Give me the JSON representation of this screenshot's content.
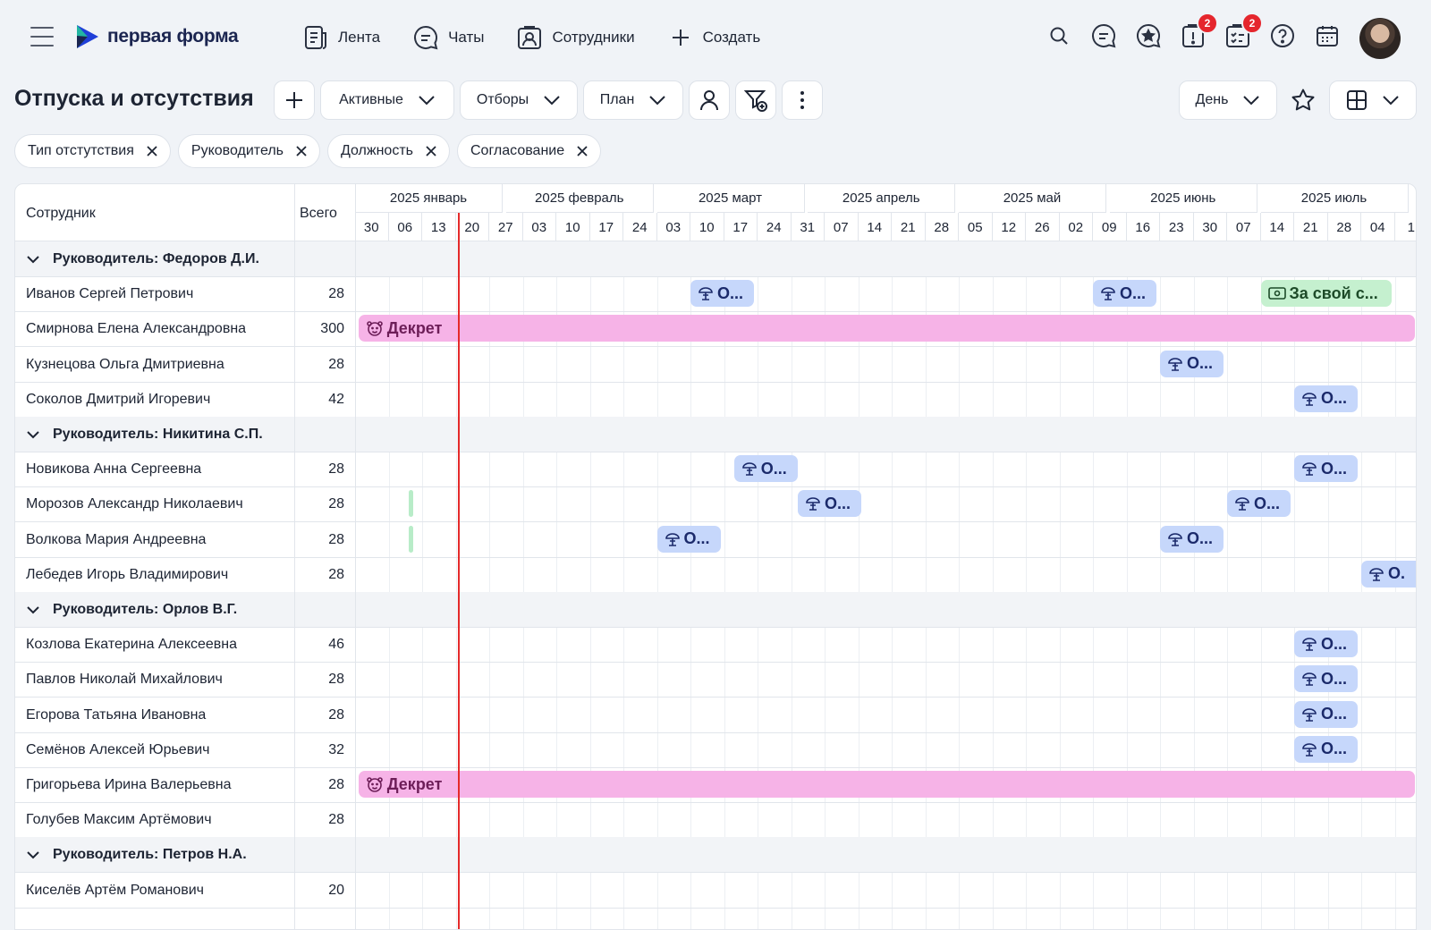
{
  "brand": {
    "name": "первая форма"
  },
  "nav": [
    {
      "label": "Лента",
      "icon": "feed-icon"
    },
    {
      "label": "Чаты",
      "icon": "chat-icon"
    },
    {
      "label": "Сотрудники",
      "icon": "employees-icon"
    },
    {
      "label": "Создать",
      "icon": "plus-icon"
    }
  ],
  "badges": {
    "alerts": "2",
    "tasks": "2"
  },
  "page": {
    "title": "Отпуска и отсутствия"
  },
  "toolbar": {
    "status": "Активные",
    "filters": "Отборы",
    "plan": "План",
    "scale": "День"
  },
  "chips": [
    "Тип отстутствия",
    "Руководитель",
    "Должность",
    "Согласование"
  ],
  "table": {
    "col_employee": "Сотрудник",
    "col_total": "Всего",
    "months": [
      "2025 январь",
      "2025 февраль",
      "2025 март",
      "2025 апрель",
      "2025 май",
      "2025 июнь",
      "2025 июль"
    ],
    "weeks": [
      "30",
      "06",
      "13",
      "20",
      "27",
      "03",
      "10",
      "17",
      "24",
      "03",
      "10",
      "17",
      "24",
      "31",
      "07",
      "14",
      "21",
      "28",
      "05",
      "12",
      "26",
      "02",
      "09",
      "16",
      "23",
      "30",
      "07",
      "14",
      "21",
      "28",
      "04",
      "1"
    ]
  },
  "rows": [
    {
      "group": "Руководитель: Федоров Д.И."
    },
    {
      "name": "Иванов Сергей Петрович",
      "total": "28"
    },
    {
      "name": "Смирнова Елена Александровна",
      "total": "300"
    },
    {
      "name": "Кузнецова Ольга Дмитриевна",
      "total": "28"
    },
    {
      "name": "Соколов Дмитрий Игоревич",
      "total": "42"
    },
    {
      "group": "Руководитель: Никитина С.П."
    },
    {
      "name": "Новикова Анна Сергеевна",
      "total": "28"
    },
    {
      "name": "Морозов Александр Николаевич",
      "total": "28"
    },
    {
      "name": "Волкова Мария Андреевна",
      "total": "28"
    },
    {
      "name": "Лебедев Игорь Владимирович",
      "total": "28"
    },
    {
      "group": "Руководитель: Орлов В.Г."
    },
    {
      "name": "Козлова Екатерина Алексеевна",
      "total": "46"
    },
    {
      "name": "Павлов Николай Михайлович",
      "total": "28"
    },
    {
      "name": "Егорова Татьяна Ивановна",
      "total": "28"
    },
    {
      "name": "Семёнов Алексей Юрьевич",
      "total": "32"
    },
    {
      "name": "Григорьева Ирина Валерьевна",
      "total": "28"
    },
    {
      "name": "Голубев Максим Артёмович",
      "total": "28"
    },
    {
      "group": "Руководитель: Петров Н.А."
    },
    {
      "name": "Киселёв Артём Романович",
      "total": "20"
    }
  ],
  "bars": {
    "vacation": "О...",
    "vacation_cut": "О.",
    "maternity": "Декрет",
    "unpaid": "За свой с..."
  },
  "colors": {
    "vacation": "#c6d7fb",
    "maternity": "#f6b3e7",
    "unpaid": "#c5f0cf",
    "today": "#e52a2a"
  }
}
